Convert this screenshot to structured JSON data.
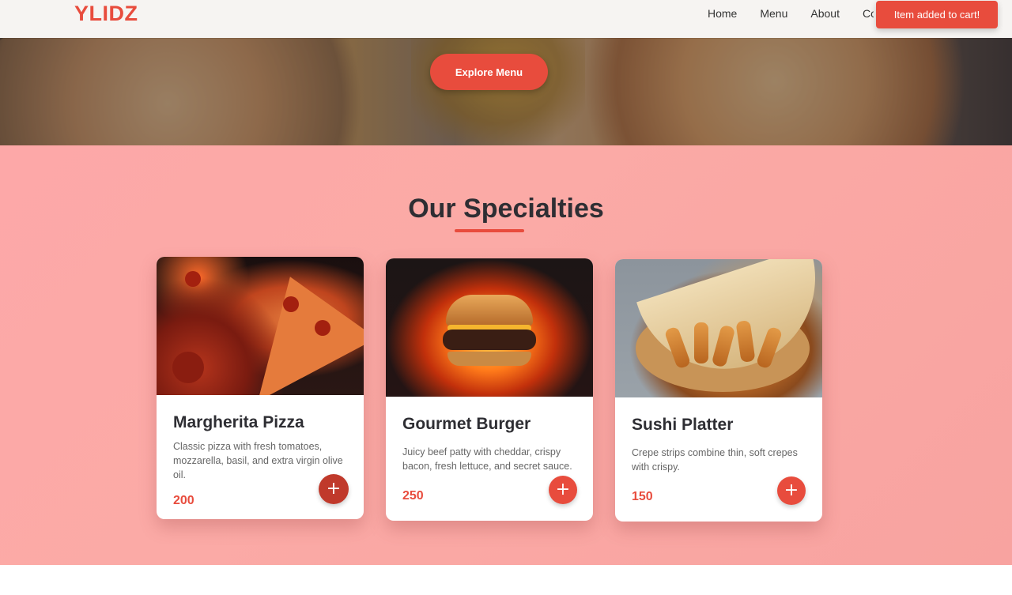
{
  "header": {
    "logo": "YLIDZ",
    "nav": [
      {
        "label": "Home"
      },
      {
        "label": "Menu"
      },
      {
        "label": "About"
      },
      {
        "label": "Contact"
      }
    ]
  },
  "toast": {
    "message": "Item added to cart!"
  },
  "hero": {
    "cta_label": "Explore Menu"
  },
  "specialties": {
    "title": "Our Specialties",
    "items": [
      {
        "name": "Margherita Pizza",
        "description": "Classic pizza with fresh tomatoes, mozzarella, basil, and extra virgin olive oil.",
        "price": "200",
        "add_label": "+",
        "image": "pizza"
      },
      {
        "name": "Gourmet Burger",
        "description": "Juicy beef patty with cheddar, crispy bacon, fresh lettuce, and secret sauce.",
        "price": "250",
        "add_label": "+",
        "image": "burger"
      },
      {
        "name": "Sushi Platter",
        "description": "Crepe strips combine thin, soft crepes with crispy.",
        "price": "150",
        "add_label": "+",
        "image": "wrap"
      }
    ]
  },
  "colors": {
    "accent": "#e84c3d",
    "section_bg": "#fca8a6",
    "text_dark": "#2e2e33"
  }
}
